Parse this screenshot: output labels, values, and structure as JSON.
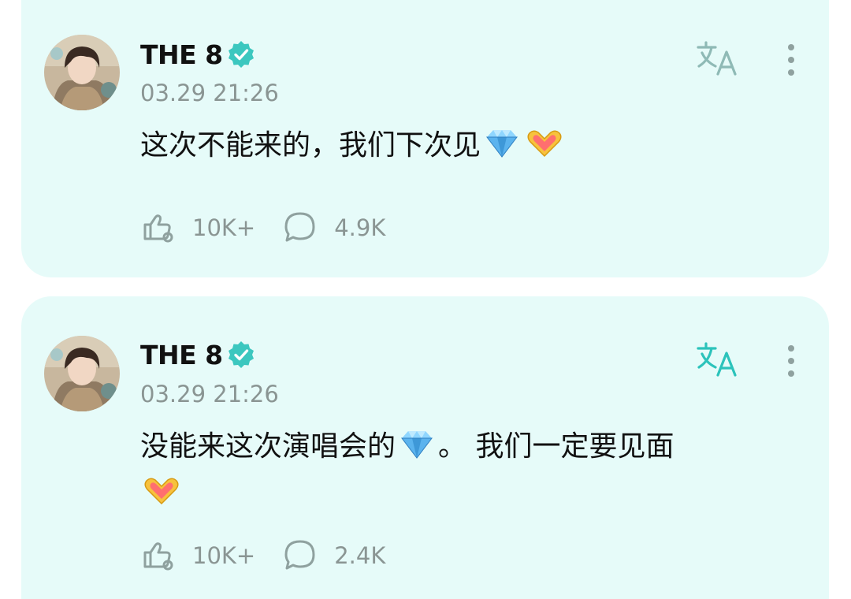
{
  "colors": {
    "card_background": "#e6fbf9",
    "verified_badge": "#3cc7bf",
    "translate_inactive": "#8fbab6",
    "translate_active": "#2cc3bb",
    "muted_text": "#8a9593"
  },
  "posts": [
    {
      "author": "THE 8",
      "verified": true,
      "timestamp": "03.29 21:26",
      "text_before": "这次不能来的，我们下次见",
      "emojis": [
        "gem-emoji",
        "heart-hands-emoji"
      ],
      "text_middle": "",
      "text_after": "",
      "likes": "10K+",
      "comments": "4.9K",
      "translate_icon": "translate-icon",
      "translate_active": false,
      "more_icon": "more-vertical-icon"
    },
    {
      "author": "THE 8",
      "verified": true,
      "timestamp": "03.29 21:26",
      "text_before": "没能来这次演唱会的",
      "emojis": [
        "gem-emoji",
        "heart-hands-emoji"
      ],
      "text_middle": "。 我们一定要见面",
      "text_after": "",
      "likes": "10K+",
      "comments": "2.4K",
      "translate_icon": "translate-icon",
      "translate_active": true,
      "more_icon": "more-vertical-icon"
    }
  ]
}
